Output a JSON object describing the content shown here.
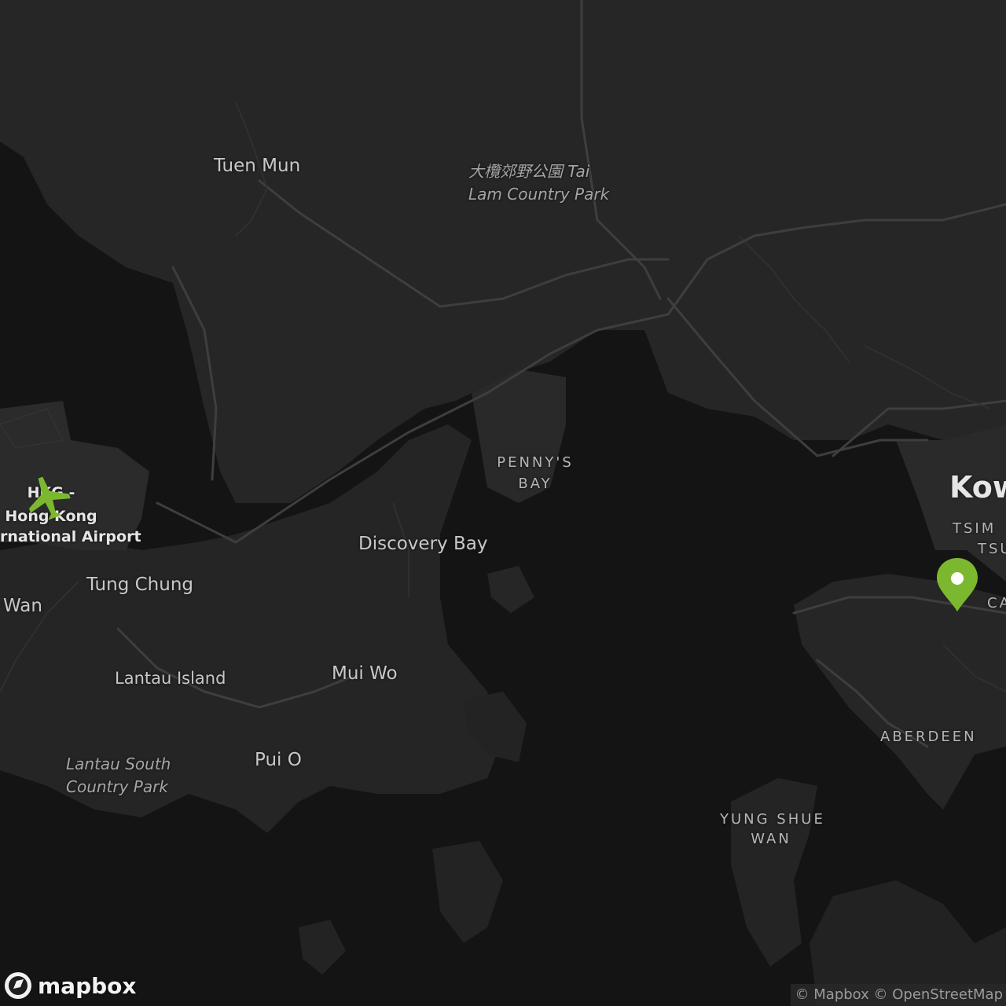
{
  "map": {
    "labels": {
      "tuen_mun": "Tuen Mun",
      "tai_lam_1": "大欖郊野公園 Tai",
      "tai_lam_2": "Lam Country Park",
      "pennys_bay_1": "PENNY'S",
      "pennys_bay_2": "BAY",
      "discovery_bay": "Discovery Bay",
      "airport_1": "HKG -",
      "airport_2": "Hong Kong",
      "airport_3": "rnational Airport",
      "tung_chung": "Tung Chung",
      "wan": "Wan",
      "lantau_island": "Lantau Island",
      "mui_wo": "Mui Wo",
      "lantau_south_1": "Lantau South",
      "lantau_south_2": "Country Park",
      "pui_o": "Pui O",
      "kowloon": "Kow",
      "tsim_1": "TSIM",
      "tsim_2": "TSU",
      "ca": "CA",
      "aberdeen": "ABERDEEN",
      "yung_shue_1": "YUNG SHUE",
      "yung_shue_2": "WAN"
    },
    "icons": {
      "airport": "airplane-icon",
      "marker": "map-pin-icon",
      "logo": "mapbox-logo-icon"
    },
    "colors": {
      "water": "#111111",
      "land": "#222222",
      "road": "#3c3c3c",
      "accent": "#7cb82f"
    }
  },
  "logo": {
    "text": "mapbox"
  },
  "attribution": {
    "text": "© Mapbox © OpenStreetMap"
  }
}
